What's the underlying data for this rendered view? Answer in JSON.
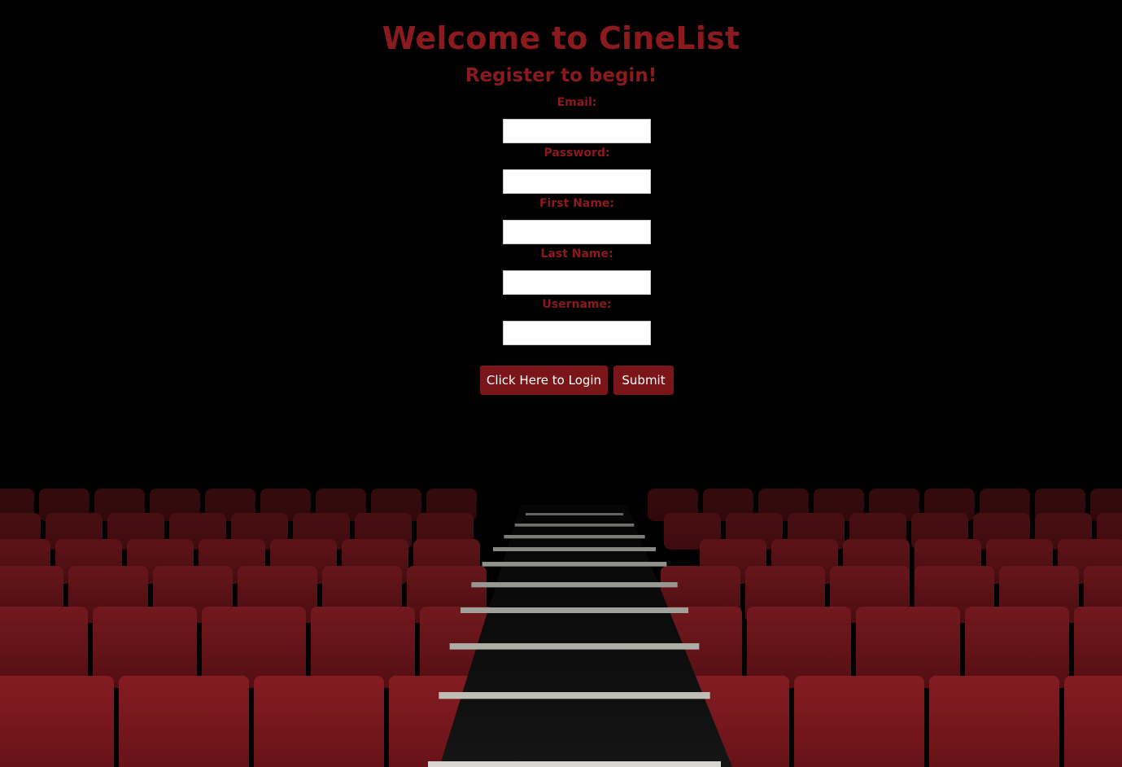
{
  "header": {
    "title": "Welcome to CineList",
    "subtitle": "Register to begin!"
  },
  "form": {
    "email_label": "Email:",
    "email_value": "",
    "password_label": "Password:",
    "password_value": "",
    "first_name_label": "First Name:",
    "first_name_value": "",
    "last_name_label": "Last Name:",
    "last_name_value": "",
    "username_label": "Username:",
    "username_value": ""
  },
  "actions": {
    "login_label": "Click Here to Login",
    "submit_label": "Submit"
  },
  "colors": {
    "accent": "#8b1a1f",
    "button_bg": "#7a1519",
    "background": "#000000",
    "seat_red": "#8a1c22"
  },
  "background_image": "theater-seats-background"
}
